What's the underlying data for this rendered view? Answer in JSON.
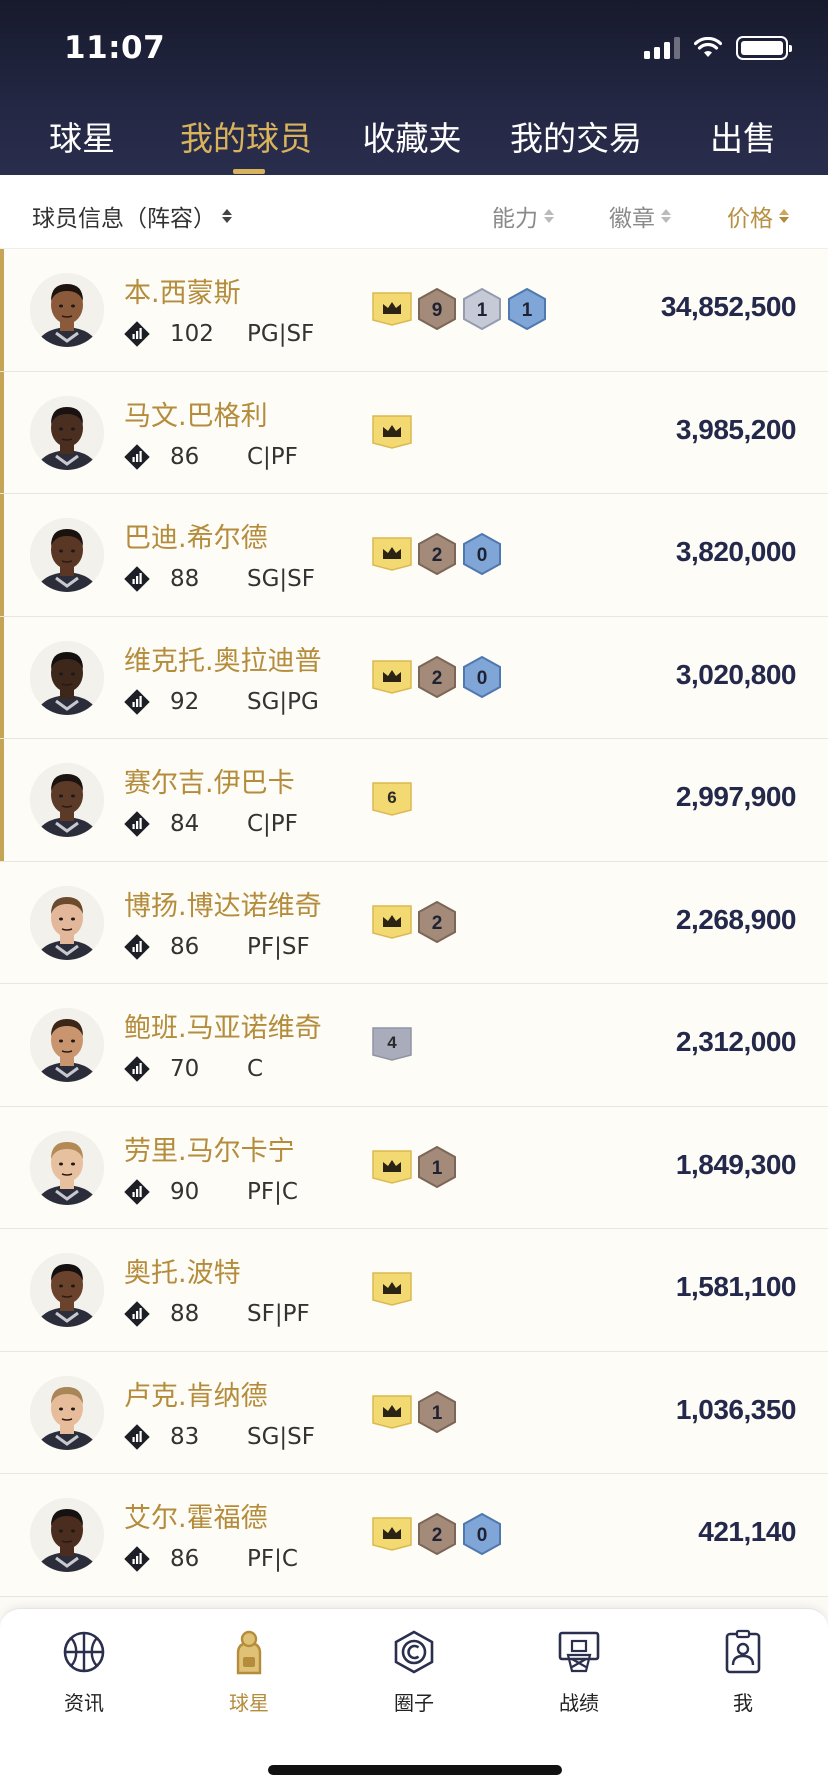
{
  "status_bar": {
    "time": "11:07"
  },
  "tabs": [
    {
      "label": "球星",
      "active": false
    },
    {
      "label": "我的球员",
      "active": true
    },
    {
      "label": "收藏夹",
      "active": false
    },
    {
      "label": "我的交易",
      "active": false
    },
    {
      "label": "出售",
      "active": false
    }
  ],
  "sort_bar": {
    "player_info": "球员信息（阵容）",
    "ability": "能力",
    "badges": "徽章",
    "price": "价格"
  },
  "players": [
    {
      "name": "本.西蒙斯",
      "rating": "102",
      "positions": "PG|SF",
      "badges": [
        {
          "type": "crown"
        },
        {
          "type": "bronze",
          "value": "9"
        },
        {
          "type": "silver",
          "value": "1"
        },
        {
          "type": "blue",
          "value": "1"
        }
      ],
      "price": "34,852,500"
    },
    {
      "name": "马文.巴格利",
      "rating": "86",
      "positions": "C|PF",
      "badges": [
        {
          "type": "crown"
        }
      ],
      "price": "3,985,200"
    },
    {
      "name": "巴迪.希尔德",
      "rating": "88",
      "positions": "SG|SF",
      "badges": [
        {
          "type": "crown"
        },
        {
          "type": "bronze",
          "value": "2"
        },
        {
          "type": "blue",
          "value": "0"
        }
      ],
      "price": "3,820,000"
    },
    {
      "name": "维克托.奥拉迪普",
      "rating": "92",
      "positions": "SG|PG",
      "badges": [
        {
          "type": "crown"
        },
        {
          "type": "bronze",
          "value": "2"
        },
        {
          "type": "blue",
          "value": "0"
        }
      ],
      "price": "3,020,800"
    },
    {
      "name": "赛尔吉.伊巴卡",
      "rating": "84",
      "positions": "C|PF",
      "badges": [
        {
          "type": "gold-num",
          "value": "6"
        }
      ],
      "price": "2,997,900"
    },
    {
      "name": "博扬.博达诺维奇",
      "rating": "86",
      "positions": "PF|SF",
      "badges": [
        {
          "type": "crown"
        },
        {
          "type": "bronze",
          "value": "2"
        }
      ],
      "price": "2,268,900"
    },
    {
      "name": "鲍班.马亚诺维奇",
      "rating": "70",
      "positions": "C",
      "badges": [
        {
          "type": "gray-num",
          "value": "4"
        }
      ],
      "price": "2,312,000"
    },
    {
      "name": "劳里.马尔卡宁",
      "rating": "90",
      "positions": "PF|C",
      "badges": [
        {
          "type": "crown"
        },
        {
          "type": "bronze",
          "value": "1"
        }
      ],
      "price": "1,849,300"
    },
    {
      "name": "奥托.波特",
      "rating": "88",
      "positions": "SF|PF",
      "badges": [
        {
          "type": "crown"
        }
      ],
      "price": "1,581,100"
    },
    {
      "name": "卢克.肯纳德",
      "rating": "83",
      "positions": "SG|SF",
      "badges": [
        {
          "type": "crown"
        },
        {
          "type": "bronze",
          "value": "1"
        }
      ],
      "price": "1,036,350"
    },
    {
      "name": "艾尔.霍福德",
      "rating": "86",
      "positions": "PF|C",
      "badges": [
        {
          "type": "crown"
        },
        {
          "type": "bronze",
          "value": "2"
        },
        {
          "type": "blue",
          "value": "0"
        }
      ],
      "price": "421,140"
    }
  ],
  "bottom_nav": [
    {
      "label": "资讯",
      "icon": "basketball-icon",
      "active": false
    },
    {
      "label": "球星",
      "icon": "player-icon",
      "active": true
    },
    {
      "label": "圈子",
      "icon": "circle-icon",
      "active": false
    },
    {
      "label": "战绩",
      "icon": "hoop-icon",
      "active": false
    },
    {
      "label": "我",
      "icon": "profile-icon",
      "active": false
    }
  ],
  "colors": {
    "accent_gold": "#b48c3c",
    "header_navy": "#232743",
    "price_navy": "#24294b"
  }
}
